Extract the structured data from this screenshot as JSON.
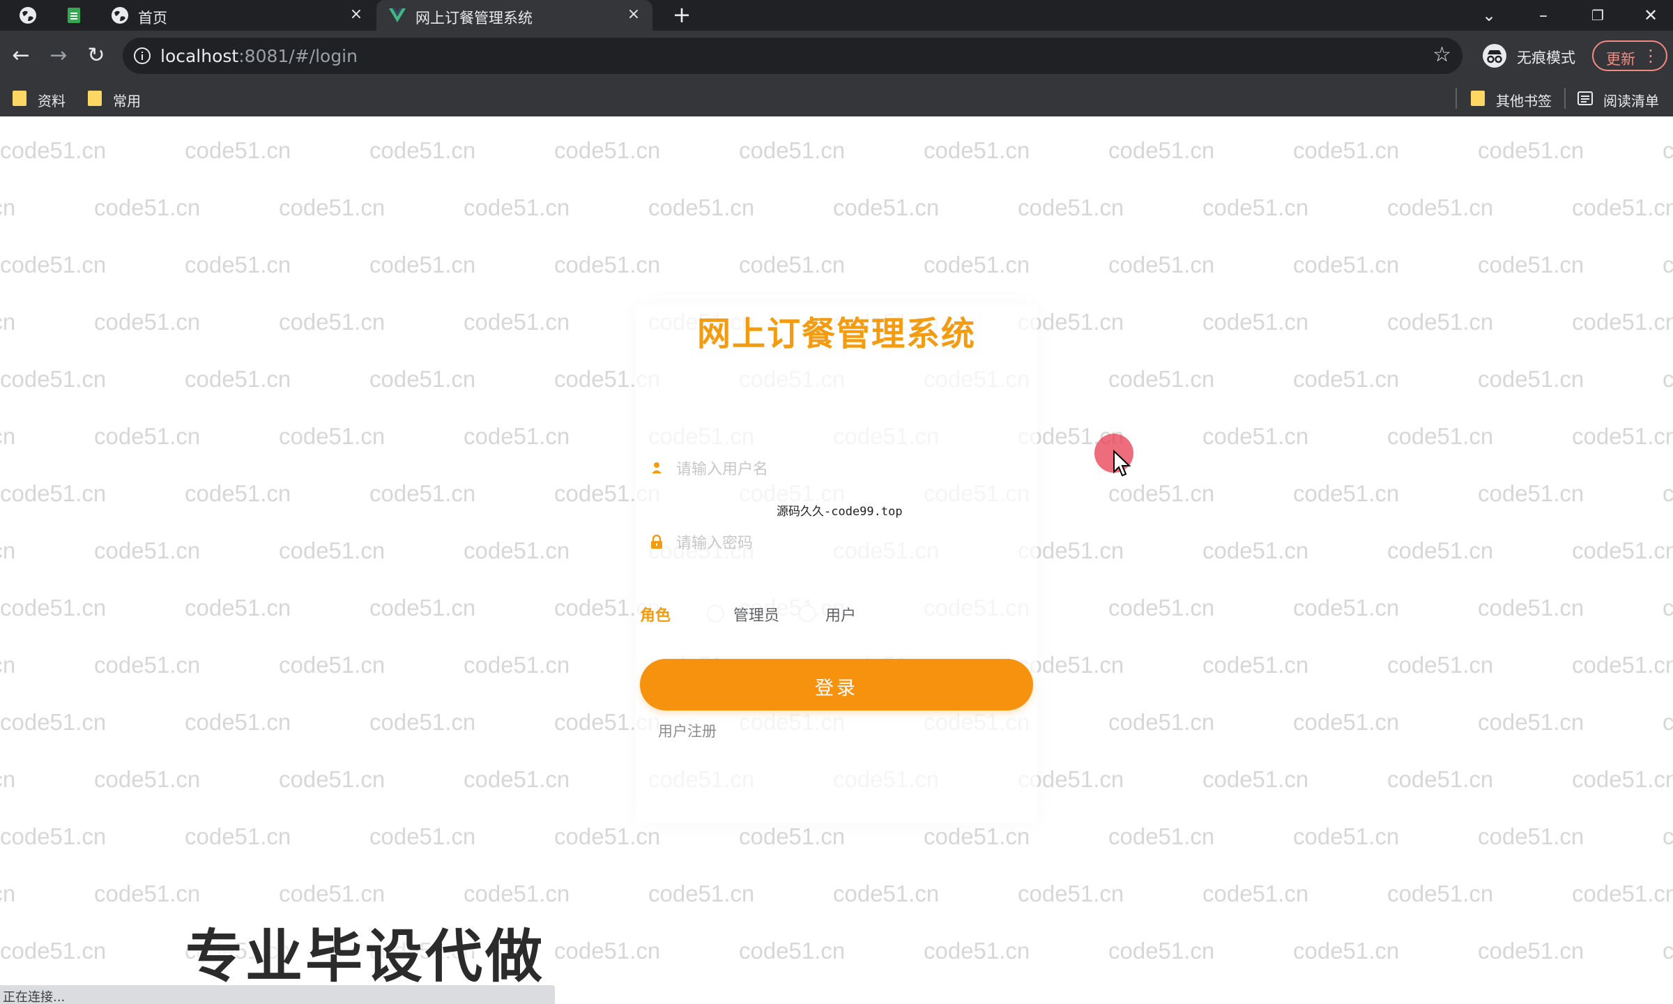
{
  "browser": {
    "tabs": [
      {
        "title": "首页",
        "close": "×"
      },
      {
        "title": "网上订餐管理系统",
        "close": "×"
      }
    ],
    "new_tab": "+",
    "url_host": "localhost",
    "url_rest": ":8081/#/login",
    "incognito_label": "无痕模式",
    "update_label": "更新",
    "bookmarks": [
      "资料",
      "常用"
    ],
    "other_bookmarks": "其他书签",
    "reading_list": "阅读清单"
  },
  "watermark": {
    "text": "code51.cn"
  },
  "login": {
    "title": "网上订餐管理系统",
    "username_placeholder": "请输入用户名",
    "password_placeholder": "请输入密码",
    "overlay_text": "源码久久-code99.top",
    "role_label": "角色",
    "roles": [
      "管理员",
      "用户"
    ],
    "login_button": "登录",
    "register_link": "用户注册"
  },
  "overlay": {
    "promo": "专业毕设代做",
    "status": "正在连接..."
  },
  "colors": {
    "accent": "#f7920f",
    "title": "#f39c12",
    "chrome_dark": "#202124",
    "chrome_toolbar": "#35363a"
  }
}
